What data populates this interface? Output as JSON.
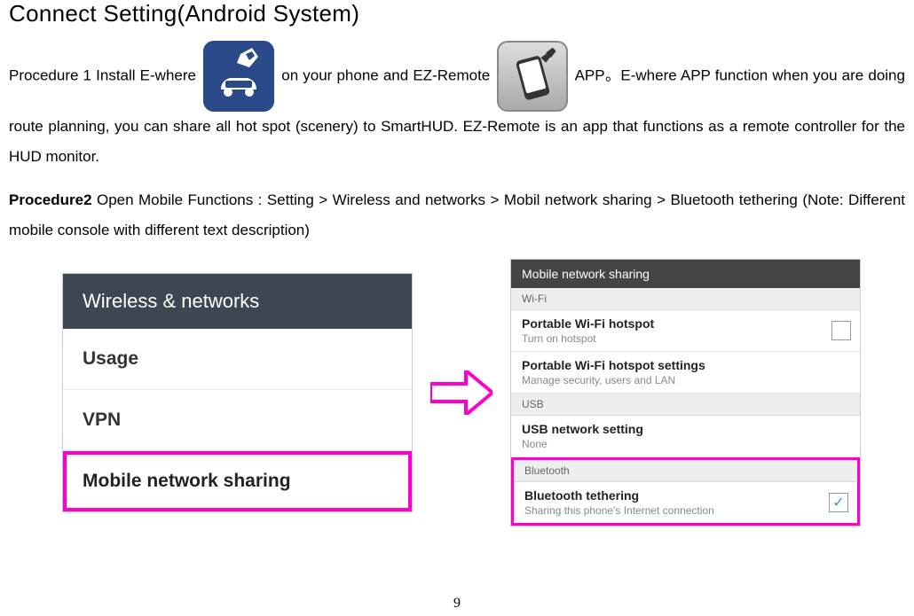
{
  "title": "Connect Setting(Android System)",
  "procedure1": {
    "part1": "Procedure 1 Install E-where",
    "part2": "on your phone and EZ-Remote",
    "part3": "APP。E-where APP function when you are doing route planning, you can share all hot spot (scenery) to SmartHUD. EZ-Remote is an app that functions as a remote controller for the HUD monitor."
  },
  "procedure2": {
    "label": "Procedure2",
    "text": " Open Mobile Functions : Setting > Wireless and networks > Mobil network sharing > Bluetooth tethering (Note: Different mobile console with different text description)"
  },
  "screenshot1": {
    "header": "Wireless & networks",
    "item1": "Usage",
    "item2": "VPN",
    "highlighted": "Mobile network sharing"
  },
  "screenshot2": {
    "header": "Mobile network sharing",
    "wifi_section": "Wi-Fi",
    "wifi_hotspot": "Portable Wi-Fi hotspot",
    "wifi_hotspot_sub": "Turn on hotspot",
    "wifi_settings": "Portable Wi-Fi hotspot settings",
    "wifi_settings_sub": "Manage security, users and LAN",
    "usb_section": "USB",
    "usb_title": "USB network setting",
    "usb_sub": "None",
    "bt_section": "Bluetooth",
    "bt_title": "Bluetooth tethering",
    "bt_sub": "Sharing this phone's Internet connection"
  },
  "page_number": "9"
}
